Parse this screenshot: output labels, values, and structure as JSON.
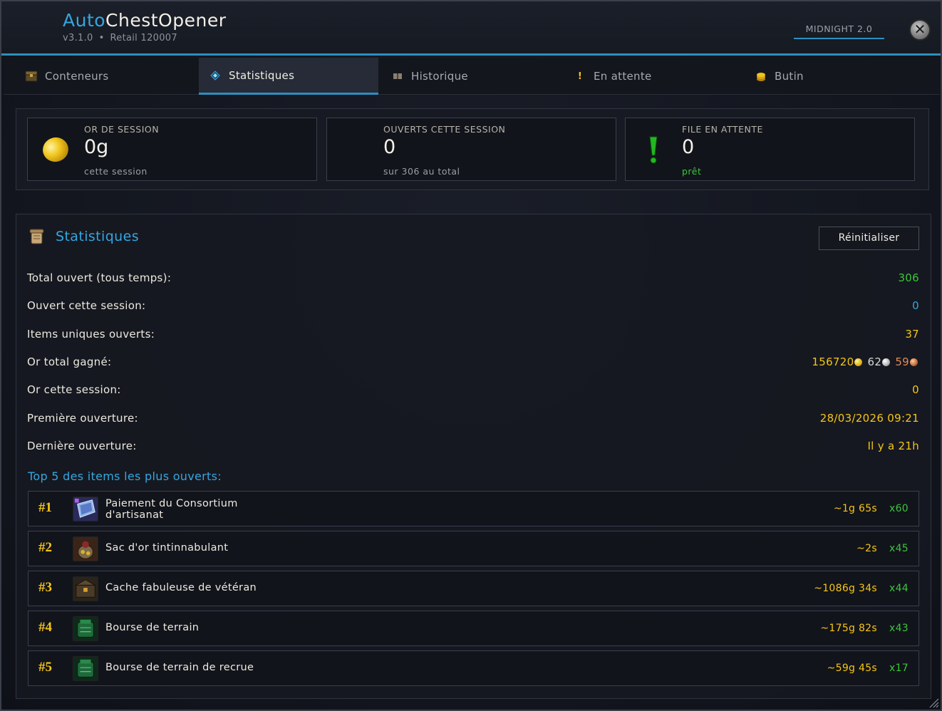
{
  "app": {
    "title_accent": "Auto",
    "title_rest": "ChestOpener",
    "version": "v3.1.0",
    "separator": "•",
    "build": "Retail 120007",
    "expansion": "MIDNIGHT 2.0",
    "close_icon": "close-icon"
  },
  "tabs": [
    {
      "label": "Conteneurs",
      "icon": "chest-icon",
      "active": false
    },
    {
      "label": "Statistiques",
      "icon": "diamond-icon",
      "active": true
    },
    {
      "label": "Historique",
      "icon": "book-icon",
      "active": false
    },
    {
      "label": "En attente",
      "icon": "exclamation-icon",
      "active": false
    },
    {
      "label": "Butin",
      "icon": "coins-icon",
      "active": false
    }
  ],
  "cards": [
    {
      "label": "OR DE SESSION",
      "value": "0g",
      "sub": "cette session",
      "icon": "gold-coin-icon"
    },
    {
      "label": "OUVERTS CETTE SESSION",
      "value": "0",
      "sub": "sur 306 au total",
      "icon": ""
    },
    {
      "label": "FILE EN ATTENTE",
      "value": "0",
      "sub": "prêt",
      "icon": "exclamation-icon"
    }
  ],
  "stats": {
    "title": "Statistiques",
    "reset_label": "Réinitialiser",
    "rows": [
      {
        "label": "Total ouvert (tous temps):",
        "value": "306",
        "color": "#3cc43c"
      },
      {
        "label": "Ouvert cette session:",
        "value": "0",
        "color": "#35a6e0"
      },
      {
        "label": "Items uniques ouverts:",
        "value": "37",
        "color": "#f5c518"
      },
      {
        "label": "Or total gagné:",
        "gold": "156720",
        "silver": "62",
        "copper": "59"
      },
      {
        "label": "Or cette session:",
        "value": "0",
        "color": "#f5c518"
      },
      {
        "label": "Première ouverture:",
        "value": "28/03/2026 09:21",
        "color": "#f5c518"
      },
      {
        "label": "Dernière ouverture:",
        "value": "Il y a 21h",
        "color": "#f5c518"
      }
    ],
    "top_title": "Top 5 des items les plus ouverts:",
    "top_items": [
      {
        "rank": "#1",
        "name": "Paiement du Consortium d'artisanat",
        "price": "~1g 65s",
        "count": "x60",
        "icon": "consortium-payment-icon"
      },
      {
        "rank": "#2",
        "name": "Sac d'or tintinnabulant",
        "price": "~2s",
        "count": "x45",
        "icon": "gold-sack-icon"
      },
      {
        "rank": "#3",
        "name": "Cache fabuleuse de vétéran",
        "price": "~1086g 34s",
        "count": "x44",
        "icon": "veteran-cache-icon"
      },
      {
        "rank": "#4",
        "name": "Bourse de terrain",
        "price": "~175g 82s",
        "count": "x43",
        "icon": "field-purse-icon"
      },
      {
        "rank": "#5",
        "name": "Bourse de terrain de recrue",
        "price": "~59g 45s",
        "count": "x17",
        "icon": "recruit-purse-icon"
      }
    ]
  }
}
